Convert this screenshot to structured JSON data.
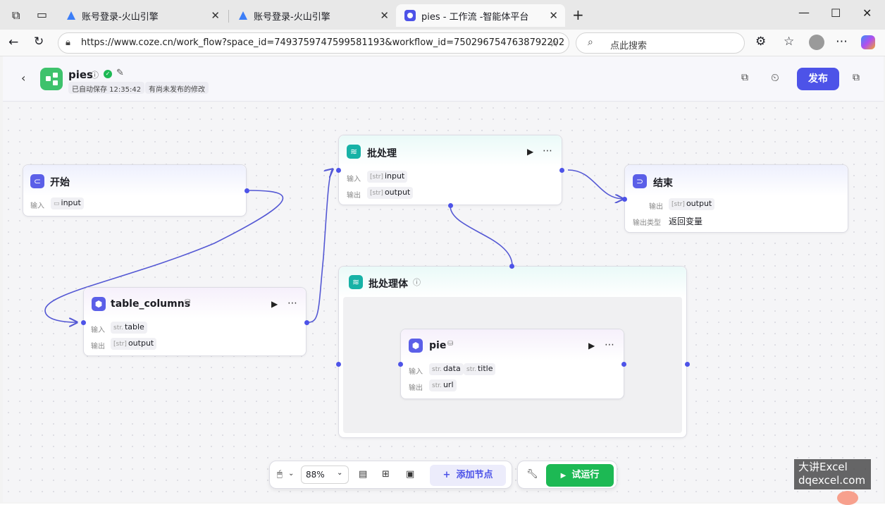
{
  "browser": {
    "tabs": [
      {
        "title": "账号登录-火山引擎"
      },
      {
        "title": "账号登录-火山引擎"
      },
      {
        "title": "pies - 工作流 -智能体平台"
      }
    ],
    "new_tab": "+",
    "url": "https://www.coze.cn/work_flow?space_id=7493759747599581193&workflow_id=7502967547638792202",
    "search_placeholder": "点此搜索"
  },
  "app": {
    "workflow_name": "pies",
    "autosave": "已自动保存 12:35:42",
    "unpublished": "有尚未发布的修改",
    "publish_label": "发布"
  },
  "nodes": {
    "start": {
      "title": "开始",
      "input_label": "输入",
      "input_var": "input"
    },
    "table_columns": {
      "title": "table_columns",
      "input_label": "输入",
      "output_label": "输出",
      "input_type": "str.",
      "input_var": "table",
      "output_type": "[str]",
      "output_var": "output"
    },
    "batch": {
      "title": "批处理",
      "input_label": "输入",
      "output_label": "输出",
      "input_type": "[str]",
      "input_var": "input",
      "output_type": "[str]",
      "output_var": "output"
    },
    "end": {
      "title": "结束",
      "output_label": "输出",
      "output_type": "[str]",
      "output_var": "output",
      "output_kind_label": "输出类型",
      "output_kind": "返回变量"
    },
    "batch_body": {
      "title": "批处理体"
    },
    "pie": {
      "title": "pie",
      "input_label": "输入",
      "output_label": "输出",
      "in1_type": "str.",
      "in1_var": "data",
      "in2_type": "str.",
      "in2_var": "title",
      "out_type": "str.",
      "out_var": "url"
    }
  },
  "toolbar": {
    "zoom": "88%",
    "add_node_label": "添加节点",
    "test_run_label": "试运行"
  },
  "watermark": {
    "line1": "大讲Excel",
    "line2": "dqexcel.com"
  },
  "colors": {
    "accent": "#4d53e8",
    "run": "#1db954",
    "start_icon": "#5b5fe8",
    "batch_icon": "#17b2a6"
  }
}
